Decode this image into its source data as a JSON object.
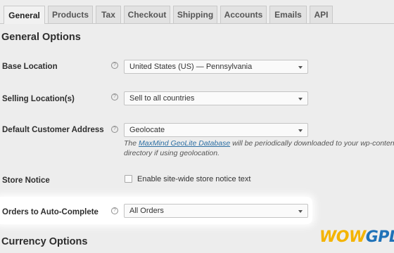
{
  "tabs": [
    "General",
    "Products",
    "Tax",
    "Checkout",
    "Shipping",
    "Accounts",
    "Emails",
    "API"
  ],
  "section_title": "General Options",
  "help_glyph": "?",
  "base_location": {
    "label": "Base Location",
    "value": "United States (US) — Pennsylvania"
  },
  "selling_locations": {
    "label": "Selling Location(s)",
    "value": "Sell to all countries"
  },
  "default_customer_address": {
    "label": "Default Customer Address",
    "value": "Geolocate",
    "desc_prefix": "The ",
    "desc_link": "MaxMind GeoLite Database",
    "desc_suffix": " will be periodically downloaded to your wp-content directory if using geolocation."
  },
  "store_notice": {
    "label": "Store Notice",
    "checkbox_label": "Enable site-wide store notice text",
    "checked": false
  },
  "orders_auto_complete": {
    "label": "Orders to Auto-Complete",
    "value": "All Orders"
  },
  "next_section_title": "Currency Options",
  "logo": {
    "part1": "WOW",
    "part2": "GPL"
  },
  "colors": {
    "page_bg": "#ededed",
    "link": "#2d6fa3",
    "logo_yellow": "#f4b400",
    "logo_blue": "#1f72b8"
  }
}
